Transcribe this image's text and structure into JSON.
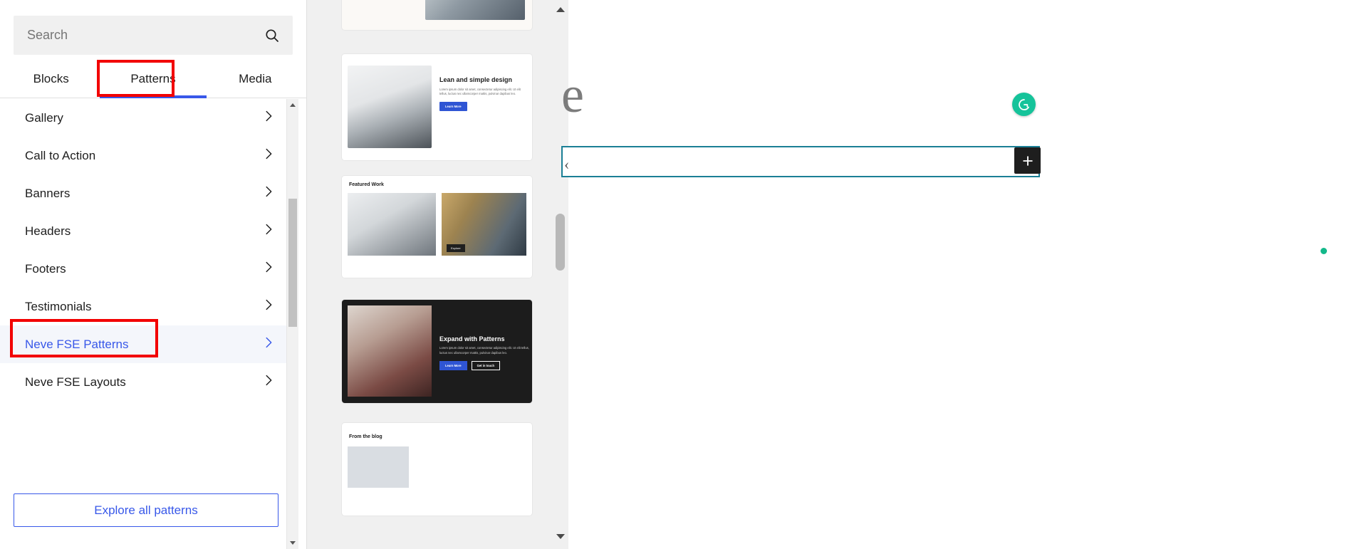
{
  "inserter": {
    "search": {
      "placeholder": "Search",
      "value": "",
      "icon": "search-icon"
    },
    "tabs": [
      {
        "label": "Blocks",
        "active": false
      },
      {
        "label": "Patterns",
        "active": true
      },
      {
        "label": "Media",
        "active": false
      }
    ],
    "categories": [
      {
        "label": "Gallery",
        "selected": false,
        "chevron": "chevron-right-icon"
      },
      {
        "label": "Call to Action",
        "selected": false,
        "chevron": "chevron-right-icon"
      },
      {
        "label": "Banners",
        "selected": false,
        "chevron": "chevron-right-icon"
      },
      {
        "label": "Headers",
        "selected": false,
        "chevron": "chevron-right-icon"
      },
      {
        "label": "Footers",
        "selected": false,
        "chevron": "chevron-right-icon"
      },
      {
        "label": "Testimonials",
        "selected": false,
        "chevron": "chevron-right-icon"
      },
      {
        "label": "Neve FSE Patterns",
        "selected": true,
        "chevron": "chevron-right-icon"
      },
      {
        "label": "Neve FSE Layouts",
        "selected": false,
        "chevron": "chevron-right-icon"
      }
    ],
    "explore_button": "Explore all patterns",
    "scrollbar": {
      "up_icon": "triangle-up-icon",
      "down_icon": "triangle-down-icon"
    }
  },
  "preview": {
    "scrollbar": {
      "up_icon": "triangle-up-icon",
      "down_icon": "triangle-down-icon"
    },
    "cards": [
      {
        "name": "pattern-card-partial-top"
      },
      {
        "title": "Lean and simple design",
        "text": "Lorem ipsum dolor sit amet, consectetur adipiscing elit. Ut elit tellus, luctus nec ullamcorper mattis, pulvinar dapibus leo.",
        "button": "Learn More"
      },
      {
        "title": "Featured Work",
        "button": "Explore"
      },
      {
        "title": "Expand with Patterns",
        "text": "Lorem ipsum dolor sit amet, consectetur adipiscing elit. Ut elit tellus, luctus nec ullamcorper mattis, pulvinar dapibus leo.",
        "button_primary": "Learn More",
        "button_secondary": "Get in touch"
      },
      {
        "title": "From the blog"
      }
    ]
  },
  "canvas": {
    "title_fragment": "e",
    "block_caret": "‹",
    "add_block_icon": "plus-icon",
    "grammarly_icon": "grammarly-icon",
    "status_dot": "green-status-dot"
  },
  "annotations": [
    {
      "name": "highlight-patterns-tab",
      "color": "#f20000"
    },
    {
      "name": "highlight-neve-fse-patterns",
      "color": "#f20000"
    }
  ],
  "colors": {
    "accent_blue": "#3858e9",
    "annotation_red": "#f20000",
    "selected_bg": "#f4f6fb",
    "grammarly_green": "#15c39a",
    "block_border_teal": "#1b7f95"
  }
}
